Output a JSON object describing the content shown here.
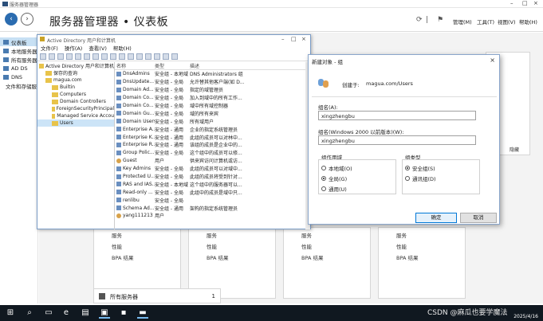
{
  "window_title": "服务器管理器",
  "header": {
    "breadcrumb_root": "服务器管理器",
    "breadcrumb_sep": "•",
    "breadcrumb_page": "仪表板",
    "menu": [
      "管理(M)",
      "工具(T)",
      "视图(V)",
      "帮助(H)"
    ]
  },
  "sidebar": {
    "items": [
      {
        "label": "仪表板",
        "active": true
      },
      {
        "label": "本地服务器"
      },
      {
        "label": "所有服务器"
      },
      {
        "label": "AD DS"
      },
      {
        "label": "DNS"
      },
      {
        "label": "文件和存储服务"
      }
    ]
  },
  "dashboard": {
    "tiles": [
      {
        "lines": [
          "服务",
          "性能",
          "BPA 结果"
        ]
      },
      {
        "lines": [
          "服务",
          "性能",
          "BPA 结果"
        ]
      },
      {
        "lines": [
          "服务",
          "性能",
          "BPA 结果"
        ]
      },
      {
        "lines": [
          "服务",
          "性能",
          "BPA 结果"
        ]
      }
    ],
    "all_servers_label": "所有服务器",
    "all_servers_count": "1",
    "hide_label": "隐藏"
  },
  "aduc": {
    "title": "Active Directory 用户和计算机",
    "menu": [
      "文件(F)",
      "操作(A)",
      "查看(V)",
      "帮助(H)"
    ],
    "tree": [
      {
        "label": "Active Directory 用户和计算机",
        "indent": 0
      },
      {
        "label": "保存的查询",
        "indent": 1
      },
      {
        "label": "magua.com",
        "indent": 1
      },
      {
        "label": "Builtin",
        "indent": 2
      },
      {
        "label": "Computers",
        "indent": 2
      },
      {
        "label": "Domain Controllers",
        "indent": 2
      },
      {
        "label": "ForeignSecurityPrincipal",
        "indent": 2
      },
      {
        "label": "Managed Service Accou",
        "indent": 2
      },
      {
        "label": "Users",
        "indent": 2,
        "selected": true
      }
    ],
    "columns": [
      "名称",
      "类型",
      "描述"
    ],
    "rows": [
      {
        "name": "DnsAdmins",
        "type": "安全组 - 本地域",
        "desc": "DNS Administrators 组",
        "kind": "group"
      },
      {
        "name": "DnsUpdate...",
        "type": "安全组 - 全局",
        "desc": "允许替其他客户端(如 D...",
        "kind": "group"
      },
      {
        "name": "Domain Ad...",
        "type": "安全组 - 全局",
        "desc": "指定的域管理员",
        "kind": "group"
      },
      {
        "name": "Domain Co...",
        "type": "安全组 - 全局",
        "desc": "加入到域中的所有工作...",
        "kind": "group"
      },
      {
        "name": "Domain Co...",
        "type": "安全组 - 全局",
        "desc": "域中所有域控制器",
        "kind": "group"
      },
      {
        "name": "Domain Gu...",
        "type": "安全组 - 全局",
        "desc": "域的所有来宾",
        "kind": "group"
      },
      {
        "name": "Domain Users",
        "type": "安全组 - 全局",
        "desc": "所有域用户",
        "kind": "group"
      },
      {
        "name": "Enterprise A...",
        "type": "安全组 - 通用",
        "desc": "企业的指定系统管理员",
        "kind": "group"
      },
      {
        "name": "Enterprise K...",
        "type": "安全组 - 通用",
        "desc": "此组的成员可以对林中...",
        "kind": "group"
      },
      {
        "name": "Enterprise R...",
        "type": "安全组 - 通用",
        "desc": "该组的成员是企业中的...",
        "kind": "group"
      },
      {
        "name": "Group Polic...",
        "type": "安全组 - 全局",
        "desc": "这个组中的成员可以修...",
        "kind": "group"
      },
      {
        "name": "Guest",
        "type": "用户",
        "desc": "供来宾访问计算机或访...",
        "kind": "user"
      },
      {
        "name": "Key Admins",
        "type": "安全组 - 全局",
        "desc": "此组的成员可以对域中...",
        "kind": "group"
      },
      {
        "name": "Protected U...",
        "type": "安全组 - 全局",
        "desc": "此组的成员将受到针对...",
        "kind": "group"
      },
      {
        "name": "RAS and IAS...",
        "type": "安全组 - 本地域",
        "desc": "这个组中的服务器可以...",
        "kind": "group"
      },
      {
        "name": "Read-only ...",
        "type": "安全组 - 全局",
        "desc": "此组中的成员是域中只...",
        "kind": "group"
      },
      {
        "name": "renlibu",
        "type": "安全组 - 全局",
        "desc": "",
        "kind": "group"
      },
      {
        "name": "Schema Ad...",
        "type": "安全组 - 通用",
        "desc": "架构的指定系统管理员",
        "kind": "group"
      },
      {
        "name": "yang111213",
        "type": "用户",
        "desc": "",
        "kind": "user"
      }
    ]
  },
  "dialog": {
    "title": "新建对象 - 组",
    "create_in_label": "创建于:",
    "create_in_value": "magua.com/Users",
    "group_name_label": "组名(A):",
    "group_name_value": "xingzhengbu",
    "pre2000_label": "组名(Windows 2000 以前版本)(W):",
    "pre2000_value": "xingzhengbu",
    "scope_label": "组作用域",
    "scope_options": [
      {
        "label": "本地域(O)",
        "checked": false
      },
      {
        "label": "全局(G)",
        "checked": true
      },
      {
        "label": "通用(U)",
        "checked": false
      }
    ],
    "type_label": "组类型",
    "type_options": [
      {
        "label": "安全组(S)",
        "checked": true
      },
      {
        "label": "通讯组(D)",
        "checked": false
      }
    ],
    "ok_label": "确定",
    "cancel_label": "取消"
  },
  "taskbar": {
    "date": "2025/4/16"
  },
  "watermark": "CSDN @麻瓜也要学魔法"
}
